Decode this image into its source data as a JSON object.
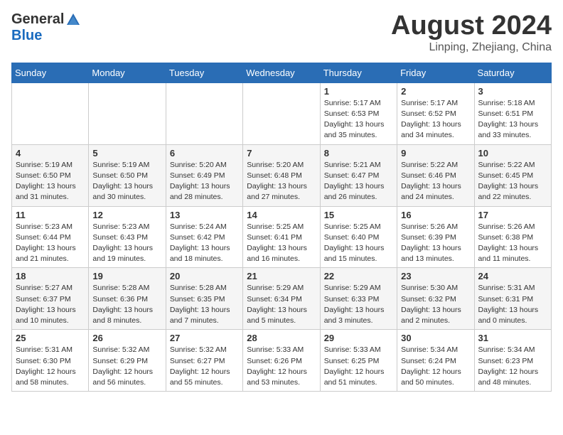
{
  "header": {
    "logo_general": "General",
    "logo_blue": "Blue",
    "month_title": "August 2024",
    "location": "Linping, Zhejiang, China"
  },
  "days_of_week": [
    "Sunday",
    "Monday",
    "Tuesday",
    "Wednesday",
    "Thursday",
    "Friday",
    "Saturday"
  ],
  "weeks": [
    [
      {
        "day": "",
        "info": ""
      },
      {
        "day": "",
        "info": ""
      },
      {
        "day": "",
        "info": ""
      },
      {
        "day": "",
        "info": ""
      },
      {
        "day": "1",
        "info": "Sunrise: 5:17 AM\nSunset: 6:53 PM\nDaylight: 13 hours\nand 35 minutes."
      },
      {
        "day": "2",
        "info": "Sunrise: 5:17 AM\nSunset: 6:52 PM\nDaylight: 13 hours\nand 34 minutes."
      },
      {
        "day": "3",
        "info": "Sunrise: 5:18 AM\nSunset: 6:51 PM\nDaylight: 13 hours\nand 33 minutes."
      }
    ],
    [
      {
        "day": "4",
        "info": "Sunrise: 5:19 AM\nSunset: 6:50 PM\nDaylight: 13 hours\nand 31 minutes."
      },
      {
        "day": "5",
        "info": "Sunrise: 5:19 AM\nSunset: 6:50 PM\nDaylight: 13 hours\nand 30 minutes."
      },
      {
        "day": "6",
        "info": "Sunrise: 5:20 AM\nSunset: 6:49 PM\nDaylight: 13 hours\nand 28 minutes."
      },
      {
        "day": "7",
        "info": "Sunrise: 5:20 AM\nSunset: 6:48 PM\nDaylight: 13 hours\nand 27 minutes."
      },
      {
        "day": "8",
        "info": "Sunrise: 5:21 AM\nSunset: 6:47 PM\nDaylight: 13 hours\nand 26 minutes."
      },
      {
        "day": "9",
        "info": "Sunrise: 5:22 AM\nSunset: 6:46 PM\nDaylight: 13 hours\nand 24 minutes."
      },
      {
        "day": "10",
        "info": "Sunrise: 5:22 AM\nSunset: 6:45 PM\nDaylight: 13 hours\nand 22 minutes."
      }
    ],
    [
      {
        "day": "11",
        "info": "Sunrise: 5:23 AM\nSunset: 6:44 PM\nDaylight: 13 hours\nand 21 minutes."
      },
      {
        "day": "12",
        "info": "Sunrise: 5:23 AM\nSunset: 6:43 PM\nDaylight: 13 hours\nand 19 minutes."
      },
      {
        "day": "13",
        "info": "Sunrise: 5:24 AM\nSunset: 6:42 PM\nDaylight: 13 hours\nand 18 minutes."
      },
      {
        "day": "14",
        "info": "Sunrise: 5:25 AM\nSunset: 6:41 PM\nDaylight: 13 hours\nand 16 minutes."
      },
      {
        "day": "15",
        "info": "Sunrise: 5:25 AM\nSunset: 6:40 PM\nDaylight: 13 hours\nand 15 minutes."
      },
      {
        "day": "16",
        "info": "Sunrise: 5:26 AM\nSunset: 6:39 PM\nDaylight: 13 hours\nand 13 minutes."
      },
      {
        "day": "17",
        "info": "Sunrise: 5:26 AM\nSunset: 6:38 PM\nDaylight: 13 hours\nand 11 minutes."
      }
    ],
    [
      {
        "day": "18",
        "info": "Sunrise: 5:27 AM\nSunset: 6:37 PM\nDaylight: 13 hours\nand 10 minutes."
      },
      {
        "day": "19",
        "info": "Sunrise: 5:28 AM\nSunset: 6:36 PM\nDaylight: 13 hours\nand 8 minutes."
      },
      {
        "day": "20",
        "info": "Sunrise: 5:28 AM\nSunset: 6:35 PM\nDaylight: 13 hours\nand 7 minutes."
      },
      {
        "day": "21",
        "info": "Sunrise: 5:29 AM\nSunset: 6:34 PM\nDaylight: 13 hours\nand 5 minutes."
      },
      {
        "day": "22",
        "info": "Sunrise: 5:29 AM\nSunset: 6:33 PM\nDaylight: 13 hours\nand 3 minutes."
      },
      {
        "day": "23",
        "info": "Sunrise: 5:30 AM\nSunset: 6:32 PM\nDaylight: 13 hours\nand 2 minutes."
      },
      {
        "day": "24",
        "info": "Sunrise: 5:31 AM\nSunset: 6:31 PM\nDaylight: 13 hours\nand 0 minutes."
      }
    ],
    [
      {
        "day": "25",
        "info": "Sunrise: 5:31 AM\nSunset: 6:30 PM\nDaylight: 12 hours\nand 58 minutes."
      },
      {
        "day": "26",
        "info": "Sunrise: 5:32 AM\nSunset: 6:29 PM\nDaylight: 12 hours\nand 56 minutes."
      },
      {
        "day": "27",
        "info": "Sunrise: 5:32 AM\nSunset: 6:27 PM\nDaylight: 12 hours\nand 55 minutes."
      },
      {
        "day": "28",
        "info": "Sunrise: 5:33 AM\nSunset: 6:26 PM\nDaylight: 12 hours\nand 53 minutes."
      },
      {
        "day": "29",
        "info": "Sunrise: 5:33 AM\nSunset: 6:25 PM\nDaylight: 12 hours\nand 51 minutes."
      },
      {
        "day": "30",
        "info": "Sunrise: 5:34 AM\nSunset: 6:24 PM\nDaylight: 12 hours\nand 50 minutes."
      },
      {
        "day": "31",
        "info": "Sunrise: 5:34 AM\nSunset: 6:23 PM\nDaylight: 12 hours\nand 48 minutes."
      }
    ]
  ]
}
